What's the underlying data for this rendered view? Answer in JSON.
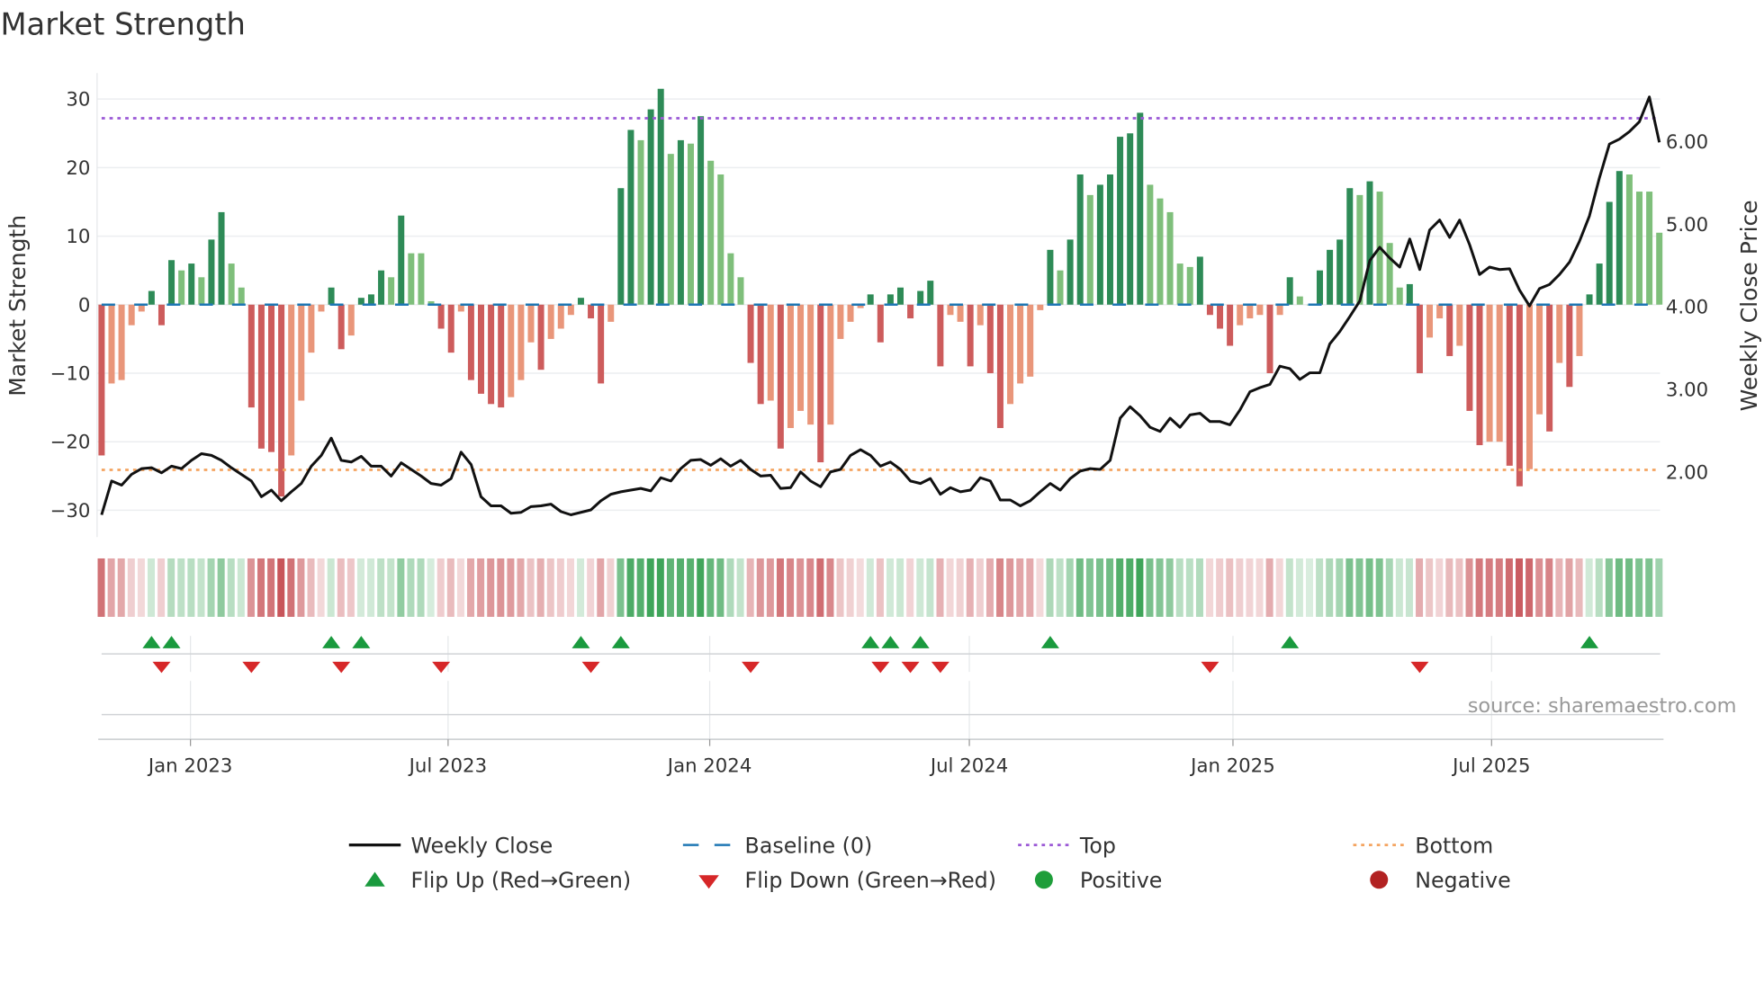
{
  "chart_data": {
    "type": "bar",
    "title": "Market Strength",
    "ylabel": "Market Strength",
    "y2label": "Weekly Close Price",
    "ylim": [
      -32.6,
      33.8
    ],
    "y2lim": [
      1.32,
      6.83
    ],
    "yticks": [
      30,
      20,
      10,
      0,
      -10,
      -20,
      -30
    ],
    "ytick_labels": [
      "30",
      "20",
      "10",
      "0",
      "−10",
      "−20",
      "−30"
    ],
    "y2ticks": [
      6,
      5,
      4,
      3,
      2
    ],
    "y2tick_labels": [
      "6.00",
      "5.00",
      "4.00",
      "3.00",
      "2.00"
    ],
    "x_unit": "week index",
    "xticks": [
      8.9,
      34.7,
      60.9,
      86.9,
      113.3,
      139.2
    ],
    "xtick_labels": [
      "Jan 2023",
      "Jul 2023",
      "Jan 2024",
      "Jul 2024",
      "Jan 2025",
      "Jul 2025"
    ],
    "top_level": 27.2,
    "bottom_level": -24.1,
    "baseline": 0,
    "strength": [
      -22,
      -11.5,
      -11,
      -3,
      -1,
      2,
      -3,
      6.5,
      5,
      6,
      4,
      9.5,
      13.5,
      6,
      2.5,
      -15,
      -21,
      -21.5,
      -28,
      -22,
      -14,
      -7,
      -1,
      2.5,
      -6.5,
      -4.5,
      1,
      1.5,
      5,
      4,
      13,
      7.5,
      7.5,
      0.5,
      -3.5,
      -7,
      -1,
      -11,
      -13,
      -14.5,
      -15,
      -13.5,
      -11,
      -5.5,
      -9.5,
      -5,
      -3.5,
      -1.5,
      1,
      -2,
      -11.5,
      -2.5,
      17,
      25.5,
      24,
      28.5,
      31.5,
      22,
      24,
      23.5,
      27.5,
      21,
      19,
      7.5,
      4,
      -8.5,
      -14.5,
      -14,
      -21,
      -18,
      -15.5,
      -17.5,
      -23,
      -17.5,
      -5,
      -2.5,
      -0.5,
      1.5,
      -5.5,
      1.5,
      2.5,
      -2,
      2,
      3.5,
      -9,
      -1.5,
      -2.5,
      -9,
      -3,
      -10,
      -18,
      -14.5,
      -11.5,
      -10.5,
      -0.8,
      8,
      5,
      9.5,
      19,
      16,
      17.5,
      19,
      24.5,
      25,
      28,
      17.5,
      15.5,
      13.5,
      6,
      5.5,
      7,
      -1.5,
      -3.5,
      -6,
      -3,
      -2,
      -1.5,
      -10,
      -1.5,
      4,
      1.2,
      0,
      5,
      8,
      9.5,
      17,
      16,
      18,
      16.5,
      9,
      2.5,
      3,
      -10,
      -4.8,
      -2,
      -7.5,
      -6,
      -15.5,
      -20.5,
      -20,
      -20,
      -23.5,
      -26.5,
      -24,
      -16,
      -18.5,
      -8.5,
      -12,
      -7.5,
      1.5,
      6,
      15,
      19.5,
      19,
      16.5,
      16.5,
      10.5
    ],
    "shade": [
      "R",
      "r",
      "r",
      "r",
      "r",
      "G",
      "R",
      "G",
      "g",
      "G",
      "g",
      "G",
      "G",
      "g",
      "g",
      "R",
      "R",
      "R",
      "R",
      "r",
      "r",
      "r",
      "r",
      "G",
      "R",
      "r",
      "G",
      "G",
      "G",
      "g",
      "G",
      "g",
      "g",
      "g",
      "R",
      "R",
      "r",
      "R",
      "R",
      "R",
      "R",
      "r",
      "r",
      "r",
      "R",
      "r",
      "r",
      "r",
      "G",
      "R",
      "R",
      "r",
      "G",
      "G",
      "g",
      "G",
      "G",
      "g",
      "G",
      "g",
      "G",
      "g",
      "g",
      "g",
      "g",
      "R",
      "R",
      "r",
      "R",
      "r",
      "r",
      "r",
      "R",
      "r",
      "r",
      "r",
      "r",
      "G",
      "R",
      "G",
      "G",
      "R",
      "G",
      "G",
      "R",
      "r",
      "r",
      "R",
      "r",
      "R",
      "R",
      "r",
      "r",
      "r",
      "r",
      "G",
      "g",
      "G",
      "G",
      "g",
      "G",
      "G",
      "G",
      "G",
      "G",
      "g",
      "g",
      "g",
      "g",
      "g",
      "G",
      "R",
      "R",
      "R",
      "r",
      "r",
      "r",
      "R",
      "r",
      "G",
      "g",
      "g",
      "G",
      "G",
      "G",
      "G",
      "g",
      "G",
      "g",
      "g",
      "g",
      "G",
      "R",
      "r",
      "r",
      "R",
      "r",
      "R",
      "R",
      "r",
      "r",
      "R",
      "R",
      "r",
      "r",
      "R",
      "r",
      "R",
      "r",
      "G",
      "G",
      "G",
      "G",
      "g",
      "g",
      "g",
      "g"
    ],
    "weekly_close": [
      1.48,
      1.89,
      1.84,
      1.97,
      2.04,
      2.05,
      1.99,
      2.07,
      2.04,
      2.14,
      2.22,
      2.2,
      2.14,
      2.05,
      1.97,
      1.89,
      1.7,
      1.78,
      1.65,
      1.76,
      1.86,
      2.07,
      2.2,
      2.41,
      2.14,
      2.12,
      2.19,
      2.07,
      2.07,
      1.95,
      2.11,
      2.03,
      1.95,
      1.86,
      1.84,
      1.92,
      2.24,
      2.09,
      1.7,
      1.59,
      1.59,
      1.5,
      1.51,
      1.58,
      1.59,
      1.61,
      1.52,
      1.48,
      1.51,
      1.54,
      1.65,
      1.73,
      1.76,
      1.78,
      1.8,
      1.77,
      1.93,
      1.89,
      2.04,
      2.14,
      2.15,
      2.08,
      2.16,
      2.07,
      2.14,
      2.03,
      1.95,
      1.96,
      1.8,
      1.81,
      2,
      1.89,
      1.82,
      2,
      2.03,
      2.2,
      2.27,
      2.2,
      2.07,
      2.12,
      2.03,
      1.89,
      1.86,
      1.92,
      1.73,
      1.81,
      1.76,
      1.78,
      1.93,
      1.89,
      1.66,
      1.66,
      1.59,
      1.65,
      1.76,
      1.86,
      1.78,
      1.92,
      2.01,
      2.04,
      2.03,
      2.14,
      2.65,
      2.79,
      2.68,
      2.54,
      2.49,
      2.65,
      2.54,
      2.69,
      2.71,
      2.61,
      2.61,
      2.57,
      2.75,
      2.97,
      3.02,
      3.06,
      3.28,
      3.25,
      3.12,
      3.2,
      3.2,
      3.55,
      3.7,
      3.88,
      4.07,
      4.56,
      4.72,
      4.59,
      4.48,
      4.82,
      4.45,
      4.93,
      5.05,
      4.84,
      5.05,
      4.75,
      4.39,
      4.48,
      4.45,
      4.46,
      4.2,
      4.01,
      4.22,
      4.27,
      4.39,
      4.54,
      4.79,
      5.1,
      5.56,
      5.97,
      6.03,
      6.12,
      6.24,
      6.54,
      5.99
    ],
    "flip_up_weeks": [
      5,
      7,
      23,
      26,
      48,
      52,
      77,
      79,
      82,
      95,
      119,
      149
    ],
    "flip_down_weeks": [
      6,
      15,
      24,
      34,
      49,
      65,
      78,
      81,
      84,
      111,
      132
    ],
    "legend": {
      "placement": "bottom",
      "items": [
        {
          "label": "Weekly Close",
          "kind": "line"
        },
        {
          "label": "Baseline (0)",
          "kind": "dash"
        },
        {
          "label": "Top",
          "kind": "dot-purple"
        },
        {
          "label": "Bottom",
          "kind": "dot-orange"
        },
        {
          "label": "Flip Up (Red→Green)",
          "kind": "tri-up"
        },
        {
          "label": "Flip Down (Green→Red)",
          "kind": "tri-down"
        },
        {
          "label": "Positive",
          "kind": "circle-green"
        },
        {
          "label": "Negative",
          "kind": "circle-red"
        }
      ]
    },
    "source": "source: sharemaestro.com",
    "colors": {
      "dark_green": "#2e8b57",
      "light_green": "#7fbf7b",
      "dark_red": "#cd5c5c",
      "light_red": "#e9967a",
      "baseline": "#1f77b4",
      "top": "#9b59d6",
      "bottom": "#f4a460",
      "line": "#111111",
      "flip_up": "#1a9a3e",
      "flip_down": "#d62728",
      "positive": "#1e9e3a",
      "negative": "#b22222"
    }
  }
}
